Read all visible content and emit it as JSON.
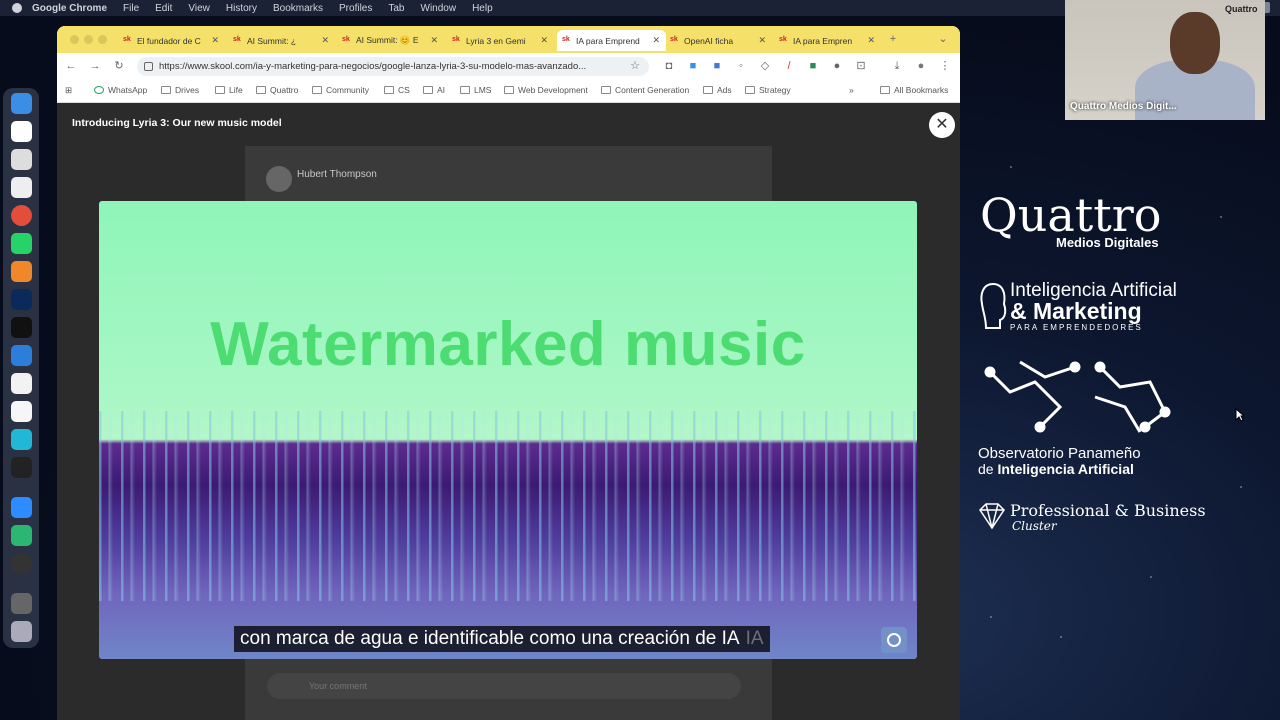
{
  "menubar": {
    "app": "Google Chrome",
    "items": [
      "File",
      "Edit",
      "View",
      "History",
      "Bookmarks",
      "Profiles",
      "Tab",
      "Window",
      "Help"
    ]
  },
  "tabs": [
    {
      "label": "El fundador de C"
    },
    {
      "label": "AI Summit: ¿"
    },
    {
      "label": "AI Summit: 😊 E"
    },
    {
      "label": "Lyria 3 en Gemi"
    },
    {
      "label": "IA para Emprend"
    },
    {
      "label": "OpenAI ficha"
    },
    {
      "label": "IA para Empren"
    }
  ],
  "address": {
    "url": "https://www.skool.com/ia-y-marketing-para-negocios/google-lanza-lyria-3-su-modelo-mas-avanzado..."
  },
  "bookmarks": [
    "WhatsApp",
    "Drives",
    "Life",
    "Quattro",
    "Community",
    "CS",
    "AI",
    "LMS",
    "Web Development",
    "Content Generation",
    "Ads",
    "Strategy"
  ],
  "bookmarks_right": "All Bookmarks",
  "modal": {
    "title": "Introducing Lyria 3: Our new music model",
    "close_glyph": "✕"
  },
  "post": {
    "author": "Hubert Thompson",
    "comment_placeholder": "Your comment"
  },
  "video": {
    "overlay_text": "Watermarked music",
    "caption": "con marca de agua e identificable como una creación de IA",
    "caption_ghost": "IA"
  },
  "webcam": {
    "name": "Quattro Medios Digit...",
    "logo": "Quattro"
  },
  "branding": {
    "quattro_main": "Quattro",
    "quattro_sub": "Medios Digitales",
    "ia_line1": "Inteligencia Artificial",
    "ia_line2": "& Marketing",
    "ia_line3": "PARA EMPRENDEDORES",
    "obs_line1": "Observatorio Panameño",
    "obs_prefix": "de ",
    "obs_line2": "Inteligencia Artificial",
    "pbc_line1": "Professional & Business",
    "pbc_line2": "Cluster"
  },
  "colors": {
    "tabbar": "#f5e06a",
    "watermark_text": "#4ddc72"
  }
}
